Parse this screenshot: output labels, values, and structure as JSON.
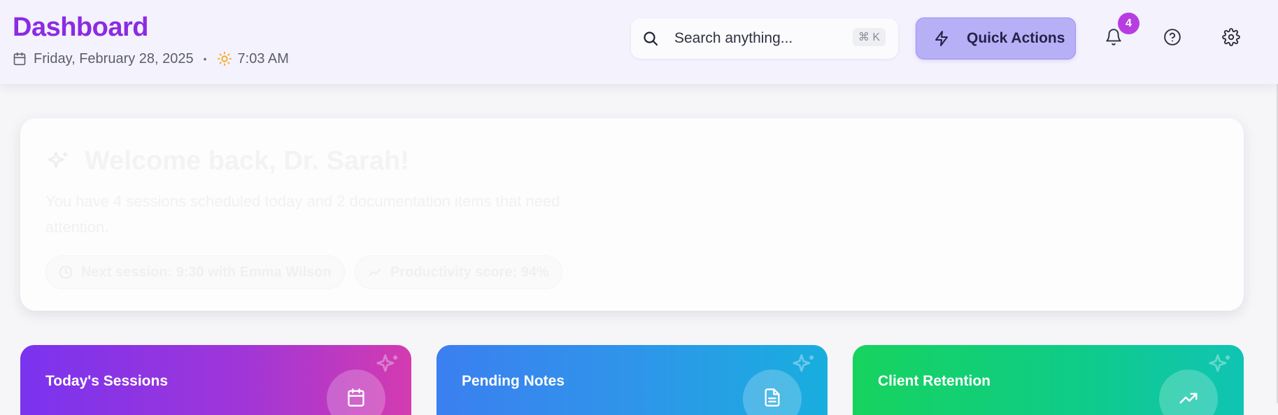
{
  "header": {
    "title": "Dashboard",
    "date": "Friday, February 28, 2025",
    "separator": "•",
    "time": "7:03 AM",
    "search_placeholder": "Search anything...",
    "search_shortcut": "⌘ K",
    "quick_actions_label": "Quick Actions",
    "notification_count": "4"
  },
  "welcome": {
    "title": "Welcome back, Dr. Sarah!",
    "message": "You have 4 sessions scheduled today and 2 documentation items that need attention.",
    "chips": [
      {
        "label": "Next session: 9:30 with Emma Wilson",
        "icon": "clock-icon"
      },
      {
        "label": "Productivity score: 94%",
        "icon": "trend-icon"
      }
    ]
  },
  "stats": [
    {
      "title": "Today's Sessions",
      "icon": "calendar-icon",
      "colors": [
        "#7a33ee",
        "#d33bb0"
      ]
    },
    {
      "title": "Pending Notes",
      "icon": "document-icon",
      "colors": [
        "#3b7ff0",
        "#18aede"
      ]
    },
    {
      "title": "Client Retention",
      "icon": "trending-up-icon",
      "colors": [
        "#17d35e",
        "#10c4b4"
      ]
    }
  ],
  "colors": {
    "brand": "#8b2be2",
    "quick_actions_bg": "#b8b0f6",
    "badge": "#b63ee0",
    "sun": "#f5a623"
  }
}
